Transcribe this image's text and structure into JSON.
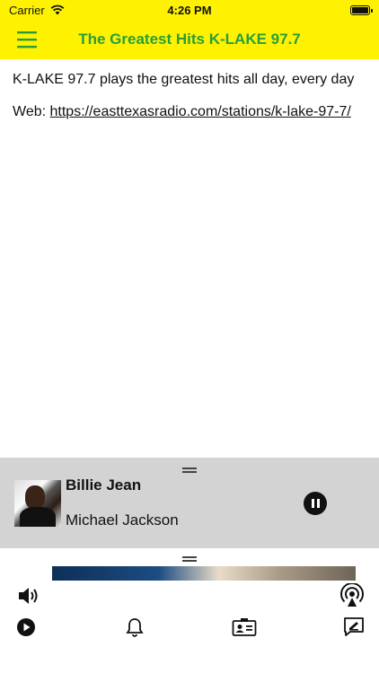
{
  "status_bar": {
    "carrier": "Carrier",
    "time": "4:26 PM"
  },
  "nav": {
    "title": "The Greatest Hits K-LAKE 97.7"
  },
  "content": {
    "description": "K-LAKE 97.7 plays the greatest hits all day, every day",
    "web_label": "Web:",
    "web_url": "https://easttexasradio.com/stations/k-lake-97-7/"
  },
  "now_playing": {
    "title": "Billie Jean",
    "artist": "Michael Jackson"
  },
  "colors": {
    "header_bg": "#fff200",
    "title": "#2a9d3a",
    "player_bg": "#d3d3d3"
  },
  "icons": [
    "wifi-icon",
    "battery-icon",
    "hamburger-menu-icon",
    "pause-icon",
    "volume-icon",
    "airplay-icon",
    "play-icon",
    "bell-icon",
    "contact-card-icon",
    "feedback-icon"
  ]
}
